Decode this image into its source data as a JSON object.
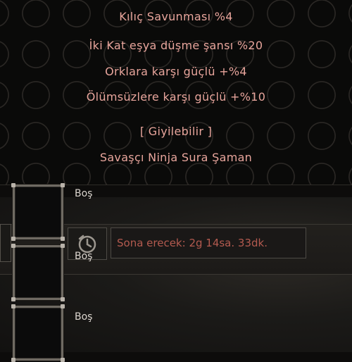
{
  "tooltip": {
    "lines": [
      "Kılıç Savunması %4",
      "İki Kat eşya düşme şansı %20",
      "Orklara karşı güçlü +%4",
      "Ölümsüzlere karşı güçlü +%10"
    ],
    "wearable": "[ Giyilebilir ]",
    "classes": "Savaşçı Ninja Sura Şaman"
  },
  "slots": [
    {
      "label": "Boş"
    },
    {
      "label": "Boş"
    },
    {
      "label": "Boş"
    }
  ],
  "timer": {
    "icon": "clock-icon",
    "text": "Sona erecek: 2g 14sa. 33dk."
  },
  "colors": {
    "tooltip_text": "#e6a29a",
    "timer_text": "#b35a4f",
    "slot_label": "#dcd6cf"
  }
}
